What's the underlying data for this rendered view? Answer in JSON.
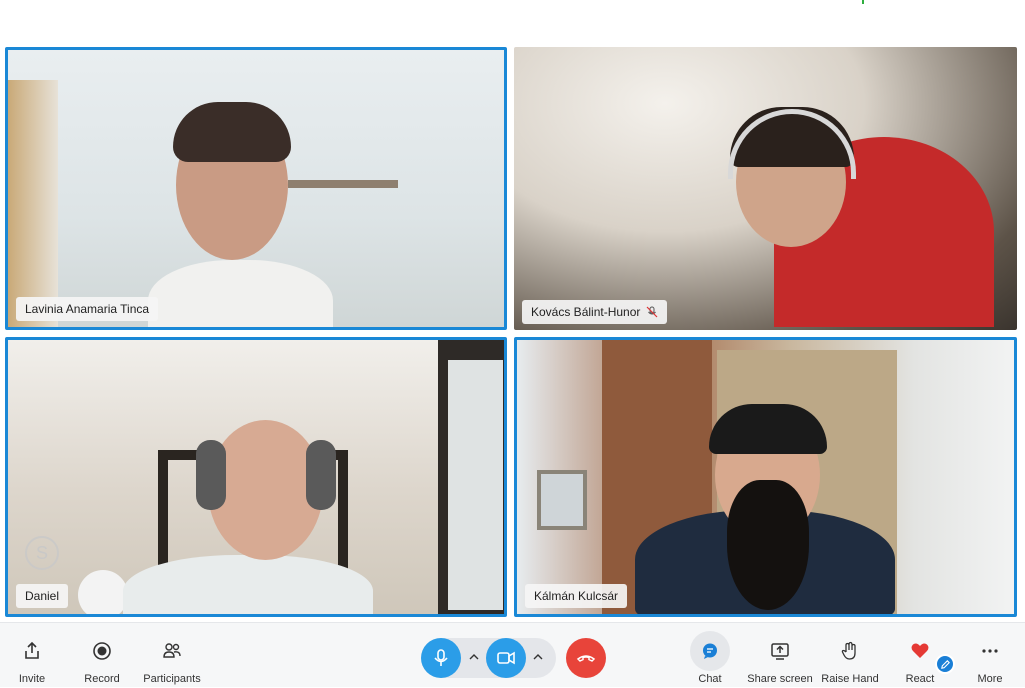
{
  "participants": [
    {
      "name": "Lavinia Anamaria Tinca",
      "active": true,
      "muted": false
    },
    {
      "name": "Kovács Bálint-Hunor",
      "active": false,
      "muted": true
    },
    {
      "name": "Daniel",
      "active": true,
      "muted": false
    },
    {
      "name": "Kálmán Kulcsár",
      "active": true,
      "muted": false
    }
  ],
  "toolbar": {
    "invite_label": "Invite",
    "record_label": "Record",
    "participants_label": "Participants",
    "chat_label": "Chat",
    "share_screen_label": "Share screen",
    "raise_hand_label": "Raise Hand",
    "react_label": "React",
    "more_label": "More"
  },
  "colors": {
    "accent": "#1a88d6",
    "mic_button": "#2b9de8",
    "end_call": "#e8443a",
    "heart": "#e53935"
  },
  "icons": {
    "invite": "share-icon",
    "record": "record-icon",
    "participants": "people-icon",
    "mic": "microphone-icon",
    "camera": "video-camera-icon",
    "end_call": "hang-up-icon",
    "chat": "chat-bubble-icon",
    "share_screen": "share-screen-icon",
    "raise_hand": "hand-icon",
    "react": "heart-icon",
    "more": "more-dots-icon"
  }
}
